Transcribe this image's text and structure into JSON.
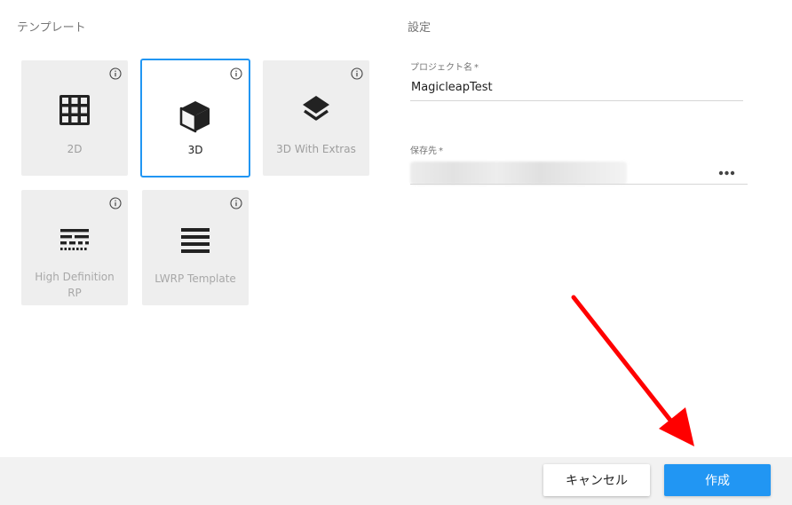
{
  "templates": {
    "title": "テンプレート",
    "items": [
      {
        "label": "2D",
        "icon": "grid-icon",
        "state": "normal"
      },
      {
        "label": "3D",
        "icon": "cube-icon",
        "state": "selected"
      },
      {
        "label": "3D With Extras",
        "icon": "layers-icon",
        "state": "normal"
      },
      {
        "label_line1": "High Definition",
        "label_line2": "RP",
        "icon": "hdrp-icon",
        "state": "disabled"
      },
      {
        "label": "LWRP Template",
        "icon": "lwrp-icon",
        "state": "disabled"
      }
    ]
  },
  "settings": {
    "title": "設定",
    "project_name": {
      "label": "プロジェクト名",
      "required_mark": "*",
      "value": "MagicleapTest"
    },
    "location": {
      "label": "保存先",
      "required_mark": "*",
      "browse_icon": "more-dots-icon"
    }
  },
  "footer": {
    "cancel_label": "キャンセル",
    "create_label": "作成"
  },
  "colors": {
    "accent": "#2196f3",
    "card_bg": "#eeeeee",
    "annotation_arrow": "#ff0000"
  }
}
